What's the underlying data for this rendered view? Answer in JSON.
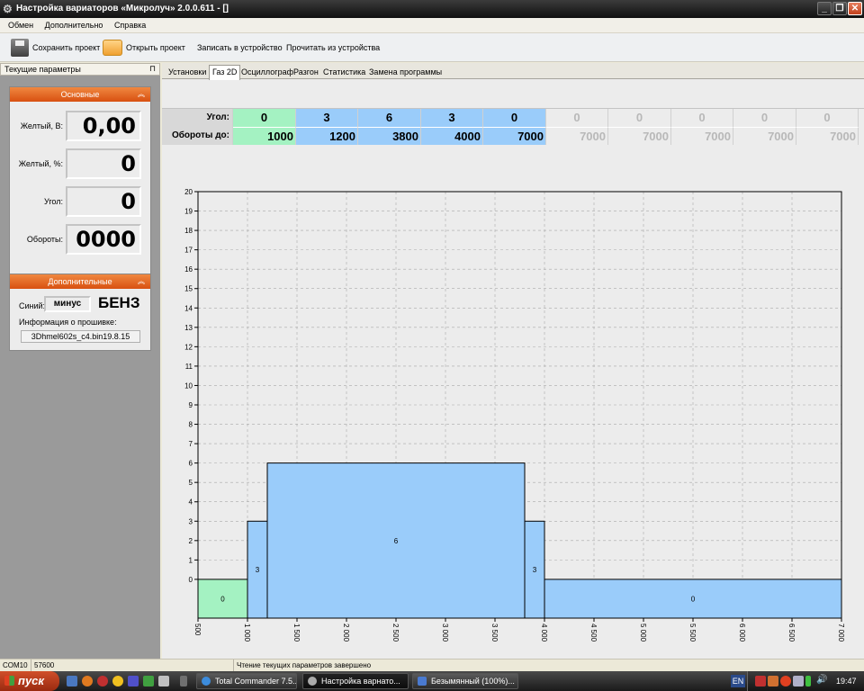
{
  "window": {
    "title": "Настройка вариаторов «Микролуч» 2.0.0.611 - []",
    "min": "_",
    "max": "❐",
    "close": "✕"
  },
  "menu": [
    "Обмен",
    "Дополнительно",
    "Справка"
  ],
  "toolbar": {
    "save": "Сохранить проект",
    "open": "Открыть проект",
    "write": "Записать в устройство",
    "read": "Прочитать из устройства"
  },
  "sidebar": {
    "title": "Текущие параметры",
    "main_group": {
      "title": "Основные",
      "fields": [
        {
          "label": "Желтый, В:",
          "value": "0,00"
        },
        {
          "label": "Желтый, %:",
          "value": "0"
        },
        {
          "label": "Угол:",
          "value": "0"
        },
        {
          "label": "Обороты:",
          "value": "0000"
        }
      ]
    },
    "extra_group": {
      "title": "Дополнительные",
      "blue_label": "Синий:",
      "blue_value": "минус",
      "fuel": "БЕНЗ",
      "fw_label": "Информация о прошивке:",
      "fw_value": "3Dhmel602s_c4.bin19.8.15"
    }
  },
  "tabs": [
    {
      "label": "Установки",
      "active": false
    },
    {
      "label": "Газ 2D",
      "active": true
    },
    {
      "label": "Осциллограф",
      "active": false
    },
    {
      "label": "Разгон",
      "active": false
    },
    {
      "label": "Статистика",
      "active": false
    },
    {
      "label": "Замена программы",
      "active": false
    }
  ],
  "table": {
    "row1_label": "Угол:",
    "row2_label": "Обороты до:",
    "angles": [
      "0",
      "3",
      "6",
      "3",
      "0",
      "0",
      "0",
      "0",
      "0",
      "0"
    ],
    "rpms": [
      "1000",
      "1200",
      "3800",
      "4000",
      "7000",
      "7000",
      "7000",
      "7000",
      "7000",
      "7000"
    ],
    "active_count": 5
  },
  "chart_data": {
    "type": "bar",
    "x_ticks": [
      "500",
      "1 000",
      "1 500",
      "2 000",
      "2 500",
      "3 000",
      "3 500",
      "4 000",
      "4 500",
      "5 000",
      "5 500",
      "6 000",
      "6 500",
      "7 000"
    ],
    "y_ticks": [
      "0",
      "1",
      "2",
      "3",
      "4",
      "5",
      "6",
      "7",
      "8",
      "9",
      "10",
      "11",
      "12",
      "13",
      "14",
      "15",
      "16",
      "17",
      "18",
      "19",
      "20"
    ],
    "xlim": [
      500,
      7000
    ],
    "ylim": [
      -2,
      20
    ],
    "grid": true,
    "bars": [
      {
        "x0": 500,
        "x1": 1000,
        "value": 0,
        "label": "0",
        "color": "#a4f2c2"
      },
      {
        "x0": 1000,
        "x1": 1200,
        "value": 3,
        "label": "3",
        "color": "#9accfa"
      },
      {
        "x0": 1200,
        "x1": 3800,
        "value": 6,
        "label": "6",
        "color": "#9accfa"
      },
      {
        "x0": 3800,
        "x1": 4000,
        "value": 3,
        "label": "3",
        "color": "#9accfa"
      },
      {
        "x0": 4000,
        "x1": 7000,
        "value": 0,
        "label": "0",
        "color": "#9accfa"
      }
    ]
  },
  "status": {
    "port": "COM10",
    "baud": "57600",
    "message": "Чтение текущих параметров завершено"
  },
  "taskbar": {
    "start": "пуск",
    "tasks": [
      "Total Commander 7.5...",
      "Настройка варнато...",
      "Безымянный (100%)..."
    ],
    "lang": "EN",
    "time": "19:47"
  },
  "colors": {
    "accent_orange": "#e06a20",
    "cell_green": "#a4f2c2",
    "cell_blue": "#9accfa"
  }
}
